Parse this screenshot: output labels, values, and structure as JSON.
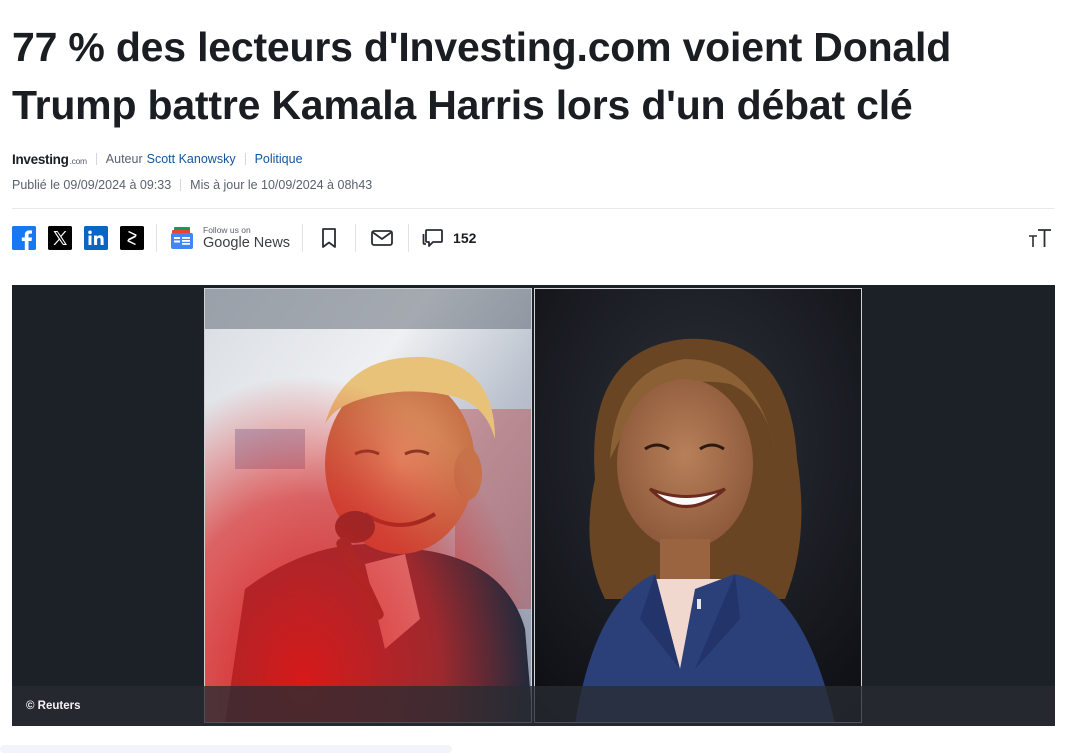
{
  "article": {
    "headline": "77 % des lecteurs d'Investing.com voient Donald Trump battre Kamala Harris lors d'un débat clé",
    "source_logo": {
      "name": "Investing",
      "suffix": ".com"
    },
    "author_label": "Auteur",
    "author_name": "Scott Kanowsky",
    "category": "Politique",
    "published": "Publié le 09/09/2024 à 09:33",
    "updated": "Mis à jour le 10/09/2024 à 08h43"
  },
  "toolbar": {
    "share_icons": [
      "facebook-icon",
      "x-icon",
      "linkedin-icon",
      "stocktwits-icon"
    ],
    "google_news_small": "Follow us on",
    "google_news_big": "Google News",
    "comments_count": "152",
    "font_size_label": "TT"
  },
  "image": {
    "caption": "© Reuters"
  },
  "colors": {
    "facebook": "#1877f2",
    "linkedin": "#0a66c2",
    "link": "#1256a0",
    "figure_bg": "#1c2128"
  }
}
